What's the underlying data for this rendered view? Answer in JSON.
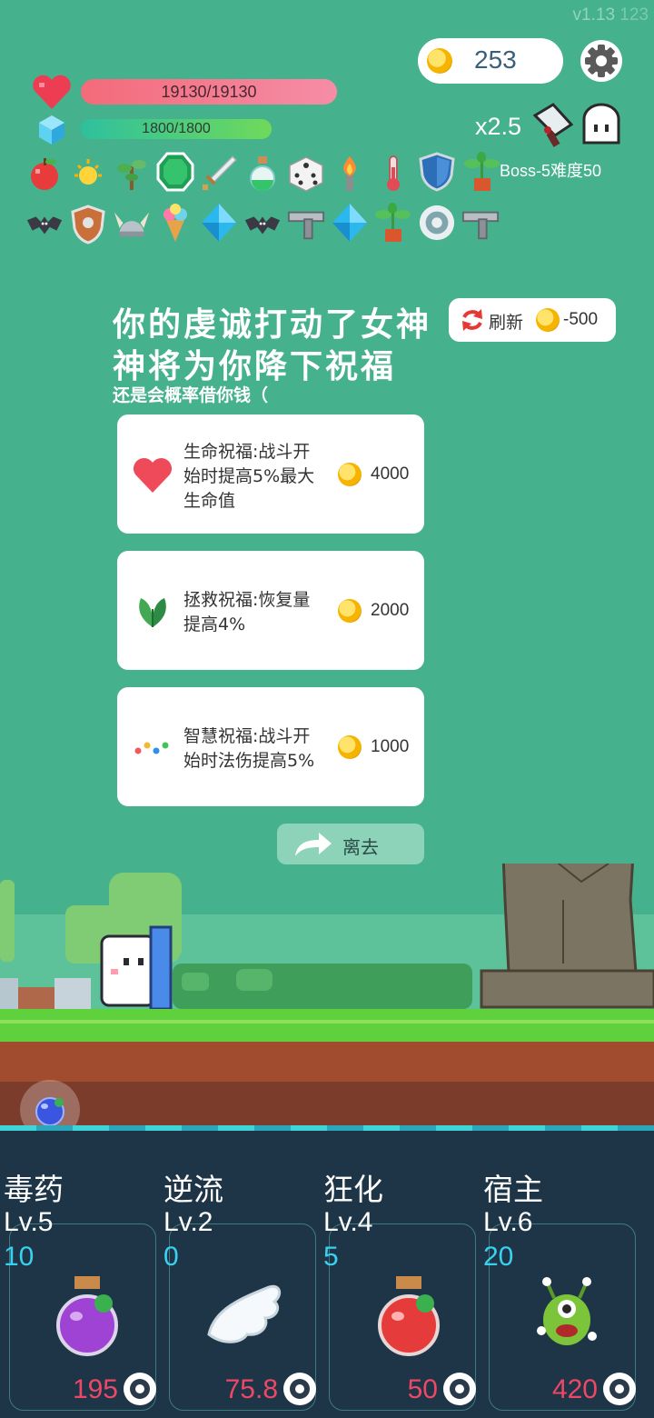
{
  "version": "v1.13",
  "version_code": "123",
  "gold": "253",
  "hp": "19130/19130",
  "mp": "1800/1800",
  "multiplier": "x2.5",
  "boss_info": "Boss-5难度50",
  "inventory_row1": [
    "apple-icon",
    "sun-icon",
    "sapling-icon",
    "emerald-icon",
    "sword-icon",
    "green-potion-icon",
    "dice-icon",
    "torch-icon",
    "thermometer-icon",
    "shield-icon",
    "potted-plant-icon"
  ],
  "inventory_row2": [
    "bat-icon",
    "round-shield-icon",
    "viking-helmet-icon",
    "ice-cream-icon",
    "blue-diamond-icon",
    "bat-icon",
    "pistol-icon",
    "blue-diamond-icon",
    "potted-plant-icon",
    "disc-icon",
    "pistol-icon"
  ],
  "event": {
    "title_line1": "你的虔诚打动了女神",
    "title_line2": "神将为你降下祝福",
    "subtitle": "还是会概率借你钱（"
  },
  "refresh": {
    "label": "刷新",
    "cost": "-500"
  },
  "blessings": [
    {
      "lines": [
        "生命祝福:战斗开",
        "始时提高5%最大",
        "生命值"
      ],
      "cost": "4000",
      "icon": "heart-icon"
    },
    {
      "lines": [
        "拯救祝福:恢复量",
        "提高4%"
      ],
      "cost": "2000",
      "icon": "leaf-icon"
    },
    {
      "lines": [
        "智慧祝福:战斗开",
        "始时法伤提高5%"
      ],
      "cost": "1000",
      "icon": "colored-dots-icon"
    }
  ],
  "leave_label": "离去",
  "skills": [
    {
      "name": "毒药",
      "level": "Lv.5",
      "count": "10",
      "price": "195",
      "icon": "purple-potion-icon"
    },
    {
      "name": "逆流",
      "level": "Lv.2",
      "count": "0",
      "price": "75.8",
      "icon": "wing-icon"
    },
    {
      "name": "狂化",
      "level": "Lv.4",
      "count": "5",
      "price": "50",
      "icon": "red-potion-icon"
    },
    {
      "name": "宿主",
      "level": "Lv.6",
      "count": "20",
      "price": "420",
      "icon": "monster-icon"
    }
  ],
  "colors": {
    "background": "#46b18d",
    "hp_bar": "#f36b7a",
    "mp_bar": "#2ec09e",
    "price": "#ef4766",
    "count": "#3ad0f0"
  }
}
